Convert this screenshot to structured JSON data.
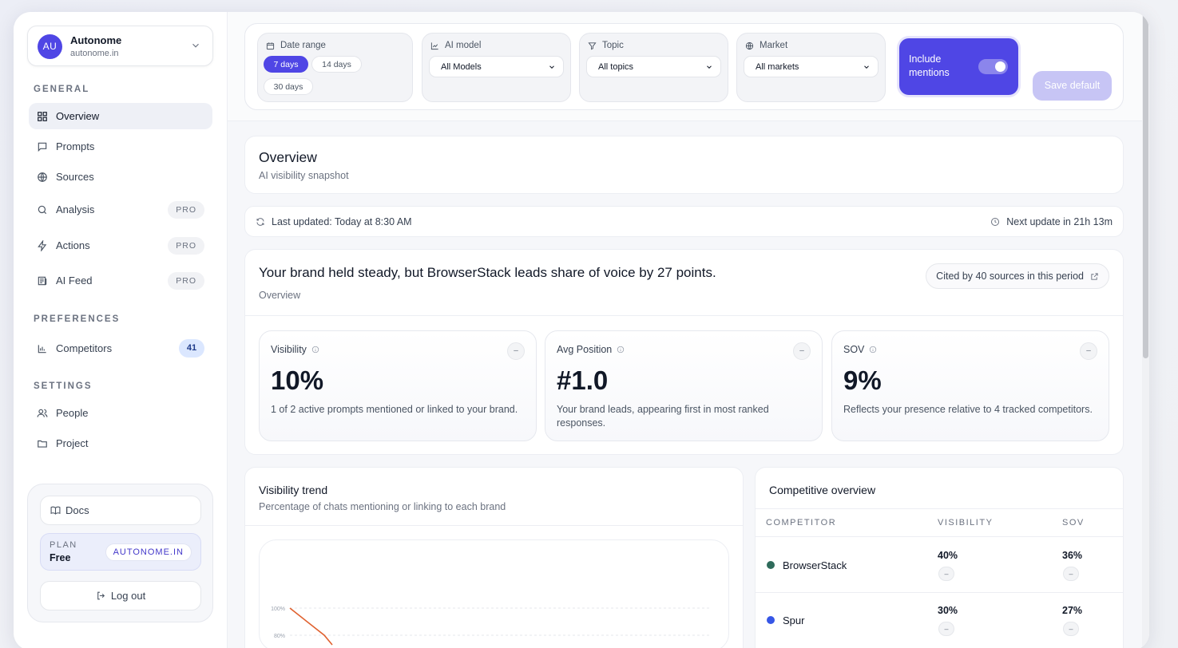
{
  "workspace": {
    "initials": "AU",
    "name": "Autonome",
    "domain": "autonome.in"
  },
  "sidebar": {
    "general_label": "GENERAL",
    "items": [
      {
        "label": "Overview",
        "icon": "grid-icon"
      },
      {
        "label": "Prompts",
        "icon": "chat-icon"
      },
      {
        "label": "Sources",
        "icon": "globe-icon"
      },
      {
        "label": "Analysis",
        "icon": "search-icon",
        "badge": "PRO"
      },
      {
        "label": "Actions",
        "icon": "bolt-icon",
        "badge": "PRO"
      },
      {
        "label": "AI Feed",
        "icon": "newspaper-icon",
        "badge": "PRO"
      }
    ],
    "preferences_label": "PREFERENCES",
    "competitors": {
      "label": "Competitors",
      "count": "41"
    },
    "settings_label": "SETTINGS",
    "people": "People",
    "project": "Project",
    "docs": "Docs",
    "plan": {
      "label": "PLAN",
      "value": "Free",
      "domain": "AUTONOME.IN"
    },
    "logout": "Log out"
  },
  "filters": {
    "date_range": {
      "label": "Date range",
      "options": [
        "7 days",
        "14 days",
        "30 days"
      ],
      "selected": "7 days"
    },
    "ai_model": {
      "label": "AI model",
      "value": "All Models"
    },
    "topic": {
      "label": "Topic",
      "value": "All topics"
    },
    "market": {
      "label": "Market",
      "value": "All markets"
    },
    "include_mentions": {
      "label": "Include mentions",
      "on": true
    },
    "save_default": "Save default"
  },
  "overview": {
    "title": "Overview",
    "subtitle": "AI visibility snapshot"
  },
  "status": {
    "last_updated": "Last updated: Today at 8:30 AM",
    "next_update": "Next update in 21h 13m"
  },
  "summary": {
    "headline": "Your brand held steady, but BrowserStack leads share of voice by 27 points.",
    "subtitle": "Overview",
    "cited": "Cited by 40 sources in this period"
  },
  "metrics": [
    {
      "label": "Visibility",
      "value": "10%",
      "desc": "1 of 2 active prompts mentioned or linked to your brand.",
      "delta": "–"
    },
    {
      "label": "Avg Position",
      "value": "#1.0",
      "desc": "Your brand leads, appearing first in most ranked responses.",
      "delta": "–"
    },
    {
      "label": "SOV",
      "value": "9%",
      "desc": "Reflects your presence relative to 4 tracked competitors.",
      "delta": "–"
    }
  ],
  "trend": {
    "title": "Visibility trend",
    "subtitle": "Percentage of chats mentioning or linking to each brand"
  },
  "chart_data": {
    "type": "line",
    "y_ticks": [
      "100%",
      "80%"
    ],
    "ylim": [
      0,
      100
    ],
    "series": [
      {
        "color": "#e0612f",
        "values": [
          100,
          80
        ]
      }
    ]
  },
  "competitive": {
    "title": "Competitive overview",
    "headers": [
      "COMPETITOR",
      "VISIBILITY",
      "SOV"
    ],
    "rows": [
      {
        "name": "BrowserStack",
        "color": "#2f6b5b",
        "visibility": "40%",
        "sov": "36%",
        "delta": "–"
      },
      {
        "name": "Spur",
        "color": "#3656e6",
        "visibility": "30%",
        "sov": "27%",
        "delta": "–"
      }
    ]
  }
}
